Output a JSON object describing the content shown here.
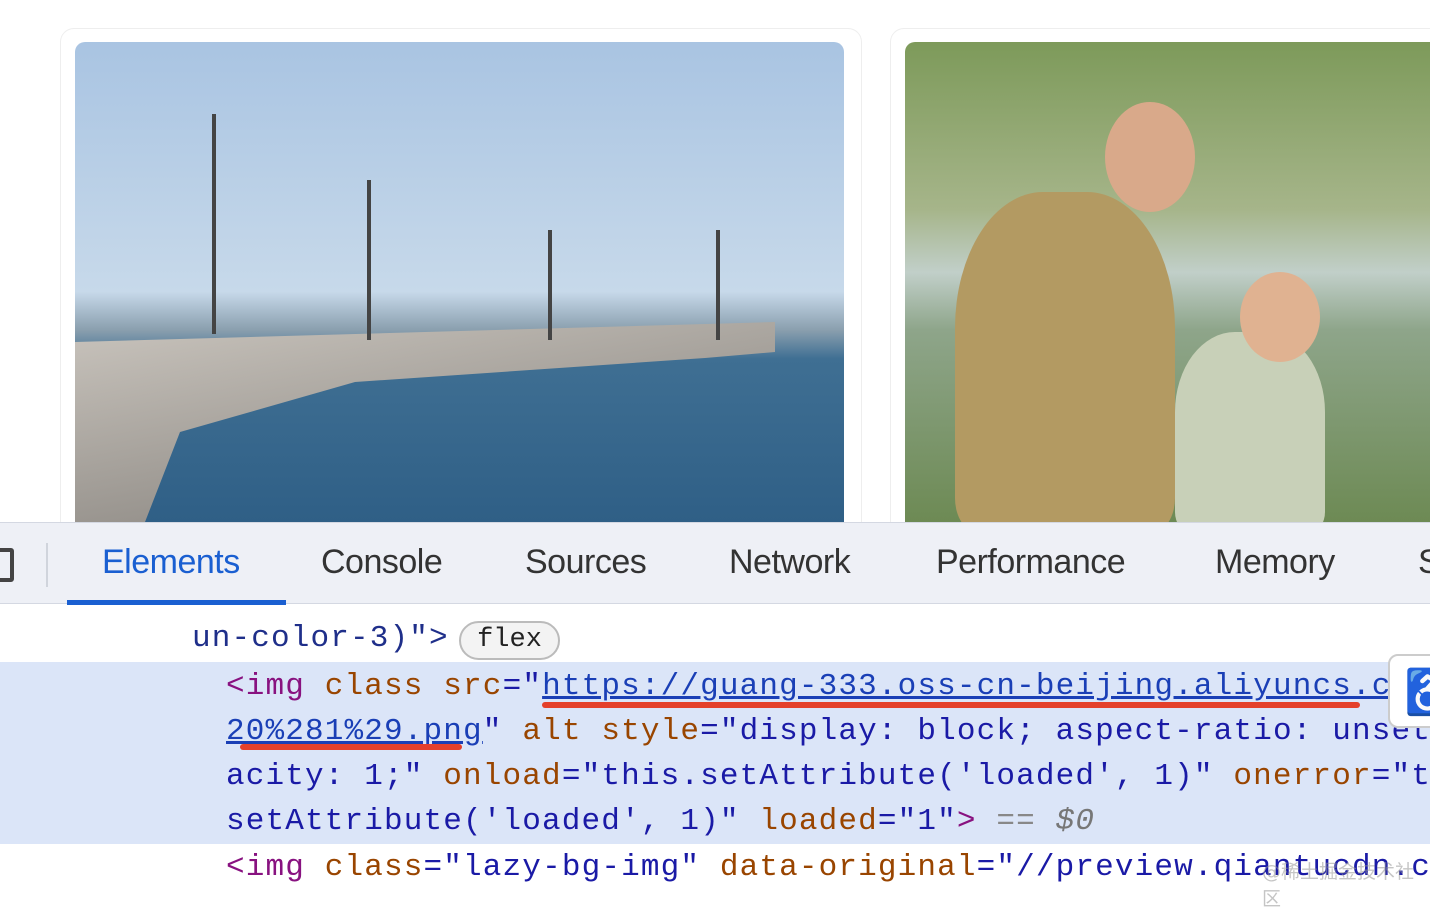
{
  "devtools": {
    "tabs": [
      {
        "label": "Elements",
        "active": true
      },
      {
        "label": "Console"
      },
      {
        "label": "Sources"
      },
      {
        "label": "Network"
      },
      {
        "label": "Performance"
      },
      {
        "label": "Memory"
      },
      {
        "label": "S"
      }
    ],
    "code": {
      "line1_text": "un-color-3)\">",
      "badge": "flex",
      "l2_tag": "<img",
      "l2_attr1": " class",
      "l2_attr2": " src",
      "l2_eq": "=\"",
      "l2_link": "https://guang-333.oss-cn-beijing.aliyuncs.c",
      "l3_link": "20%281%29.png",
      "l3_q": "\"",
      "l3_attr1": " alt",
      "l3_attr2": " style",
      "l3_val": "=\"display: block; aspect-ratio: unset",
      "l4_val": "acity: 1;\"",
      "l4_attr": " onload",
      "l4_val2": "=\"this.setAttribute('loaded', 1)\"",
      "l4_attr2": " onerror",
      "l4_val3": "=\"t",
      "l5_val": "setAttribute('loaded', 1)\"",
      "l5_attr": " loaded",
      "l5_val2": "=\"1\"",
      "l5_close": ">",
      "l5_eq": " == ",
      "l5_dollar": "$0",
      "l6_tag": "<img",
      "l6_attr": " class",
      "l6_val": "=\"lazy-bg-img\"",
      "l6_attr2": " data-original",
      "l6_val2": "=\"//preview.qiantucdn.c"
    },
    "watermark": "@稀土掘金技术社区"
  },
  "colors": {
    "accent": "#1a5fd1",
    "tag": "#881280",
    "attr": "#994500",
    "value": "#1a1aa6",
    "highlight": "#dbe5f8",
    "annotation": "#e4402b"
  }
}
